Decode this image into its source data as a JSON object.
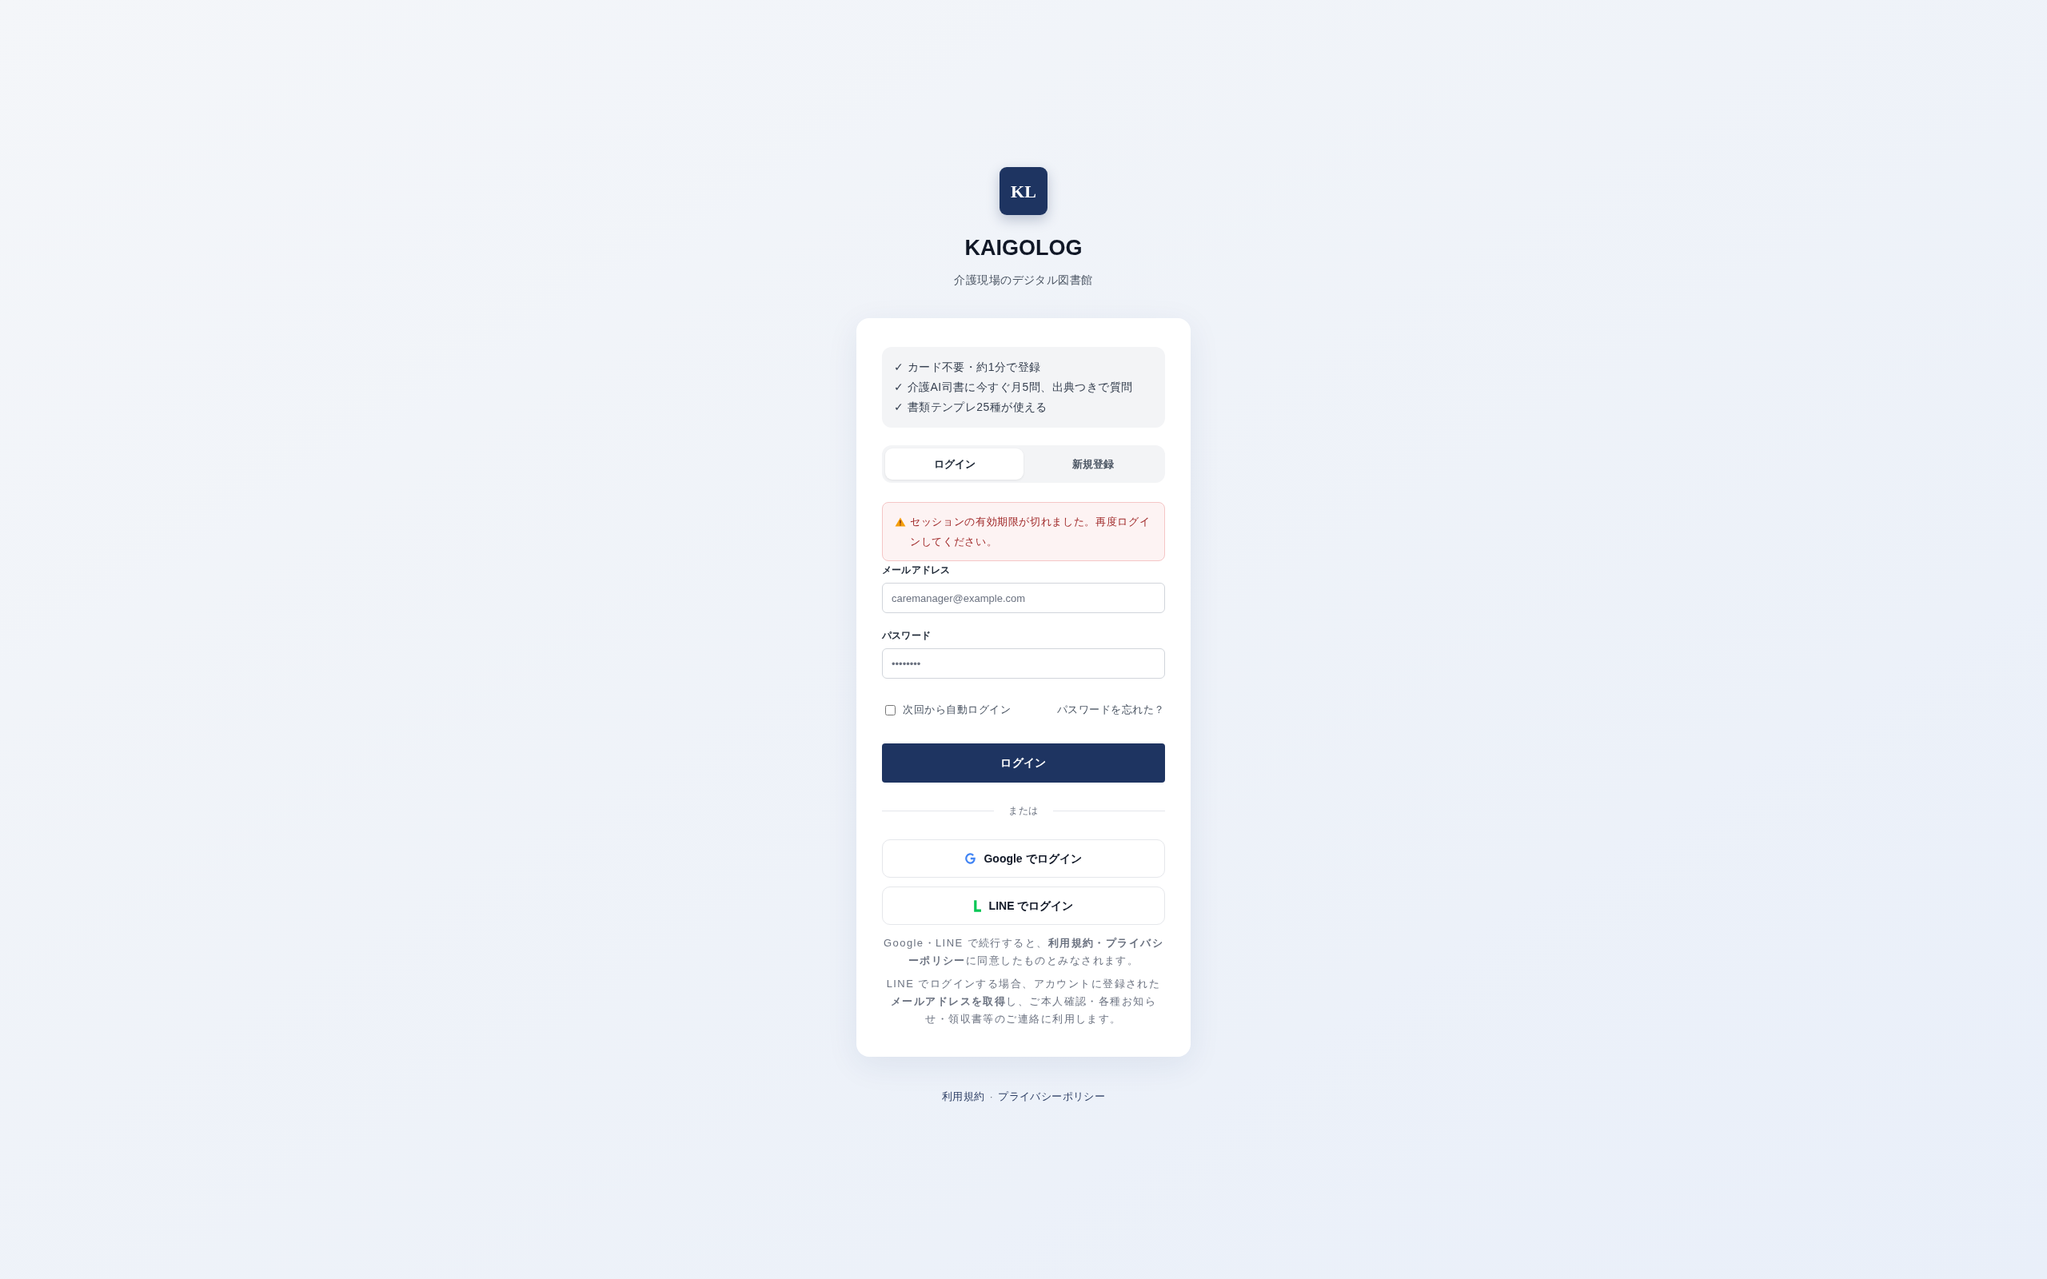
{
  "brand": {
    "logo_text": "KL",
    "name": "KAIGOLOG",
    "tagline": "介護現場のデジタル図書館"
  },
  "features": [
    "✓ カード不要・約1分で登録",
    "✓ 介護AI司書に今すぐ月5問、出典つきで質問",
    "✓ 書類テンプレ25種が使える"
  ],
  "tabs": [
    {
      "label": "ログイン",
      "selected": true
    },
    {
      "label": "新規登録",
      "selected": false
    }
  ],
  "alert": {
    "text": "セッションの有効期限が切れました。再度ログインしてください。"
  },
  "fields": [
    {
      "label": "メールアドレス",
      "placeholder": "caremanager@example.com"
    },
    {
      "label": "パスワード",
      "placeholder": "••••••••"
    }
  ],
  "remember": {
    "label": "次回から自動ログイン",
    "checked": false
  },
  "forgot_link": "パスワードを忘れた？",
  "submit_button": "ログイン",
  "divider": "または",
  "social_buttons": [
    {
      "kind": "google",
      "label": "Google でログイン"
    },
    {
      "kind": "line",
      "label": "LINE でログイン"
    }
  ],
  "notes": [
    "Google・LINE で続行すると、**利用規約・プライバシーポリシー**に同意したものとみなされます。",
    "LINE でログインする場合、アカウントに登録された**メールアドレスを取得**し、ご本人確認・各種お知らせ・領収書等のご連絡に利用します。"
  ],
  "footer": {
    "links": [
      "利用規約",
      "プライバシーポリシー"
    ],
    "separator": "·"
  }
}
